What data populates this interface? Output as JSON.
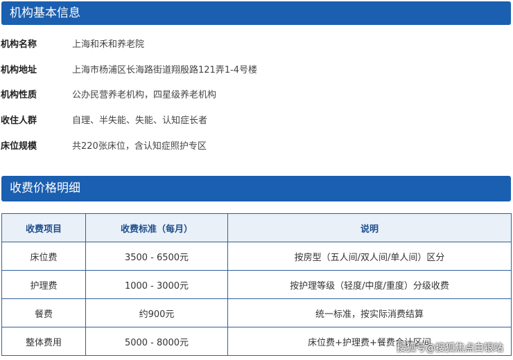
{
  "section1": {
    "title": "机构基本信息"
  },
  "info": [
    {
      "label": "机构名称",
      "value": "上海和禾和养老院"
    },
    {
      "label": "机构地址",
      "value": "上海市杨浦区长海路街道翔殷路121弄1-4号楼"
    },
    {
      "label": "机构性质",
      "value": "公办民营养老机构，四星级养老机构"
    },
    {
      "label": "收住人群",
      "value": "自理、半失能、失能、认知症长者"
    },
    {
      "label": "床位规模",
      "value": "共220张床位，含认知症照护专区"
    }
  ],
  "section2": {
    "title": "收费价格明细"
  },
  "fee_table": {
    "headers": [
      "收费项目",
      "收费标准（每月）",
      "说明"
    ],
    "rows": [
      [
        "床位费",
        "3500 - 6500元",
        "按房型（五人间/双人间/单人间）区分"
      ],
      [
        "护理费",
        "1000 - 3000元",
        "按护理等级（轻度/中度/重度）分级收费"
      ],
      [
        "餐费",
        "约900元",
        "统一标准，按实际消费结算"
      ],
      [
        "整体费用",
        "5000 - 8000元",
        "床位费+护理费+餐费合计区间"
      ]
    ]
  },
  "watermark": "搜狐号@搜狐焦点白银站",
  "colors": {
    "accent": "#1b5fb0",
    "header_bg": "#e9f0f8",
    "border": "#2c5f9e"
  }
}
